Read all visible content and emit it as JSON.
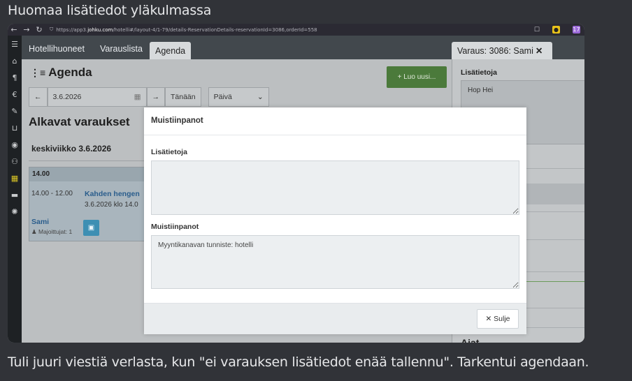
{
  "captions": {
    "top": "Huomaa lisätiedot yläkulmassa",
    "bottom": "Tuli juuri viestiä verlasta, kun \"ei varauksen lisätiedot enää tallennu\". Tarkentui agendaan."
  },
  "browser": {
    "url_prefix": "https://app3.",
    "url_host": "johku.com",
    "url_rest": "/hotelli#/layout-4/1-79/details-ReservationDetails-reservationId=3086,orderId=558",
    "ext_badge": "17"
  },
  "sidebar": {
    "icons": [
      "menu-icon",
      "home-icon",
      "restaurant-icon",
      "euro-icon",
      "brush-icon",
      "cart-icon",
      "globe-icon",
      "group-icon",
      "calendar-icon",
      "bed-icon",
      "settings-icon"
    ],
    "active": "calendar-icon"
  },
  "tabs": {
    "items": [
      "Hotellihuoneet",
      "Varauslista",
      "Agenda"
    ],
    "active": "Agenda",
    "reservation_tab": "Varaus: 3086: Sami",
    "reservation_close": "✕"
  },
  "agenda": {
    "title": "Agenda",
    "new_button": "+ Luo uusi...",
    "prev": "←",
    "date": "3.6.2026",
    "next": "→",
    "today": "Tänään",
    "view": "Päivä",
    "section": "Alkavat varaukset",
    "day": "keskiviikko 3.6.2026",
    "card": {
      "hour": "14.00",
      "times": "14.00 - 12.00",
      "room": "Kahden hengen",
      "room_sub": "3.6.2026 klo 14.0",
      "guest": "Sami",
      "occupants": "Majoittujat: 1"
    }
  },
  "right_panel": {
    "label": "Lisätietoja",
    "text": "Hop Hei",
    "footer_heading": "Ajat"
  },
  "modal": {
    "title": "Muistiinpanot",
    "field1_label": "Lisätietoja",
    "field1_value": "",
    "field2_label": "Muistiinpanot",
    "field2_value": "Myyntikanavan tunniste: hotelli",
    "close_button": "✕ Sulje"
  },
  "colors": {
    "discord_bg": "#313338",
    "new_button": "#4b7a3b",
    "link": "#2a5d8c",
    "active_icon": "#d9c526"
  }
}
